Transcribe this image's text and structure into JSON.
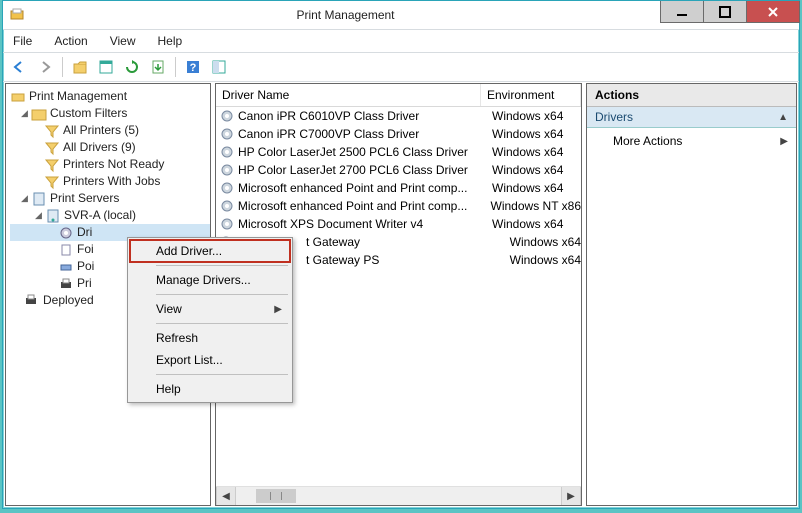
{
  "window": {
    "title": "Print Management"
  },
  "menubar": [
    "File",
    "Action",
    "View",
    "Help"
  ],
  "tree": {
    "root": "Print Management",
    "custom_filters": "Custom Filters",
    "filters": [
      "All Printers (5)",
      "All Drivers (9)",
      "Printers Not Ready",
      "Printers With Jobs"
    ],
    "print_servers": "Print Servers",
    "server": "SVR-A (local)",
    "server_children": [
      "Dri",
      "Foi",
      "Poi",
      "Pri"
    ],
    "deployed": "Deployed"
  },
  "list": {
    "headers": {
      "name": "Driver Name",
      "env": "Environment"
    },
    "rows": [
      {
        "name": "Canon iPR C6010VP Class Driver",
        "env": "Windows x64"
      },
      {
        "name": "Canon iPR C7000VP Class Driver",
        "env": "Windows x64"
      },
      {
        "name": "HP Color LaserJet 2500 PCL6 Class Driver",
        "env": "Windows x64"
      },
      {
        "name": "HP Color LaserJet 2700 PCL6 Class Driver",
        "env": "Windows x64"
      },
      {
        "name": "Microsoft enhanced Point and Print comp...",
        "env": "Windows x64"
      },
      {
        "name": "Microsoft enhanced Point and Print comp...",
        "env": "Windows NT x86"
      },
      {
        "name": "Microsoft XPS Document Writer v4",
        "env": "Windows x64"
      },
      {
        "name": "t Gateway",
        "env": "Windows x64"
      },
      {
        "name": "t Gateway PS",
        "env": "Windows x64"
      }
    ]
  },
  "actions": {
    "header": "Actions",
    "section": "Drivers",
    "item": "More Actions"
  },
  "context_menu": {
    "items": [
      {
        "label": "Add Driver...",
        "highlight": true
      },
      {
        "sep": true
      },
      {
        "label": "Manage Drivers..."
      },
      {
        "sep": true
      },
      {
        "label": "View",
        "submenu": true
      },
      {
        "sep": true
      },
      {
        "label": "Refresh"
      },
      {
        "label": "Export List..."
      },
      {
        "sep": true
      },
      {
        "label": "Help"
      }
    ]
  }
}
